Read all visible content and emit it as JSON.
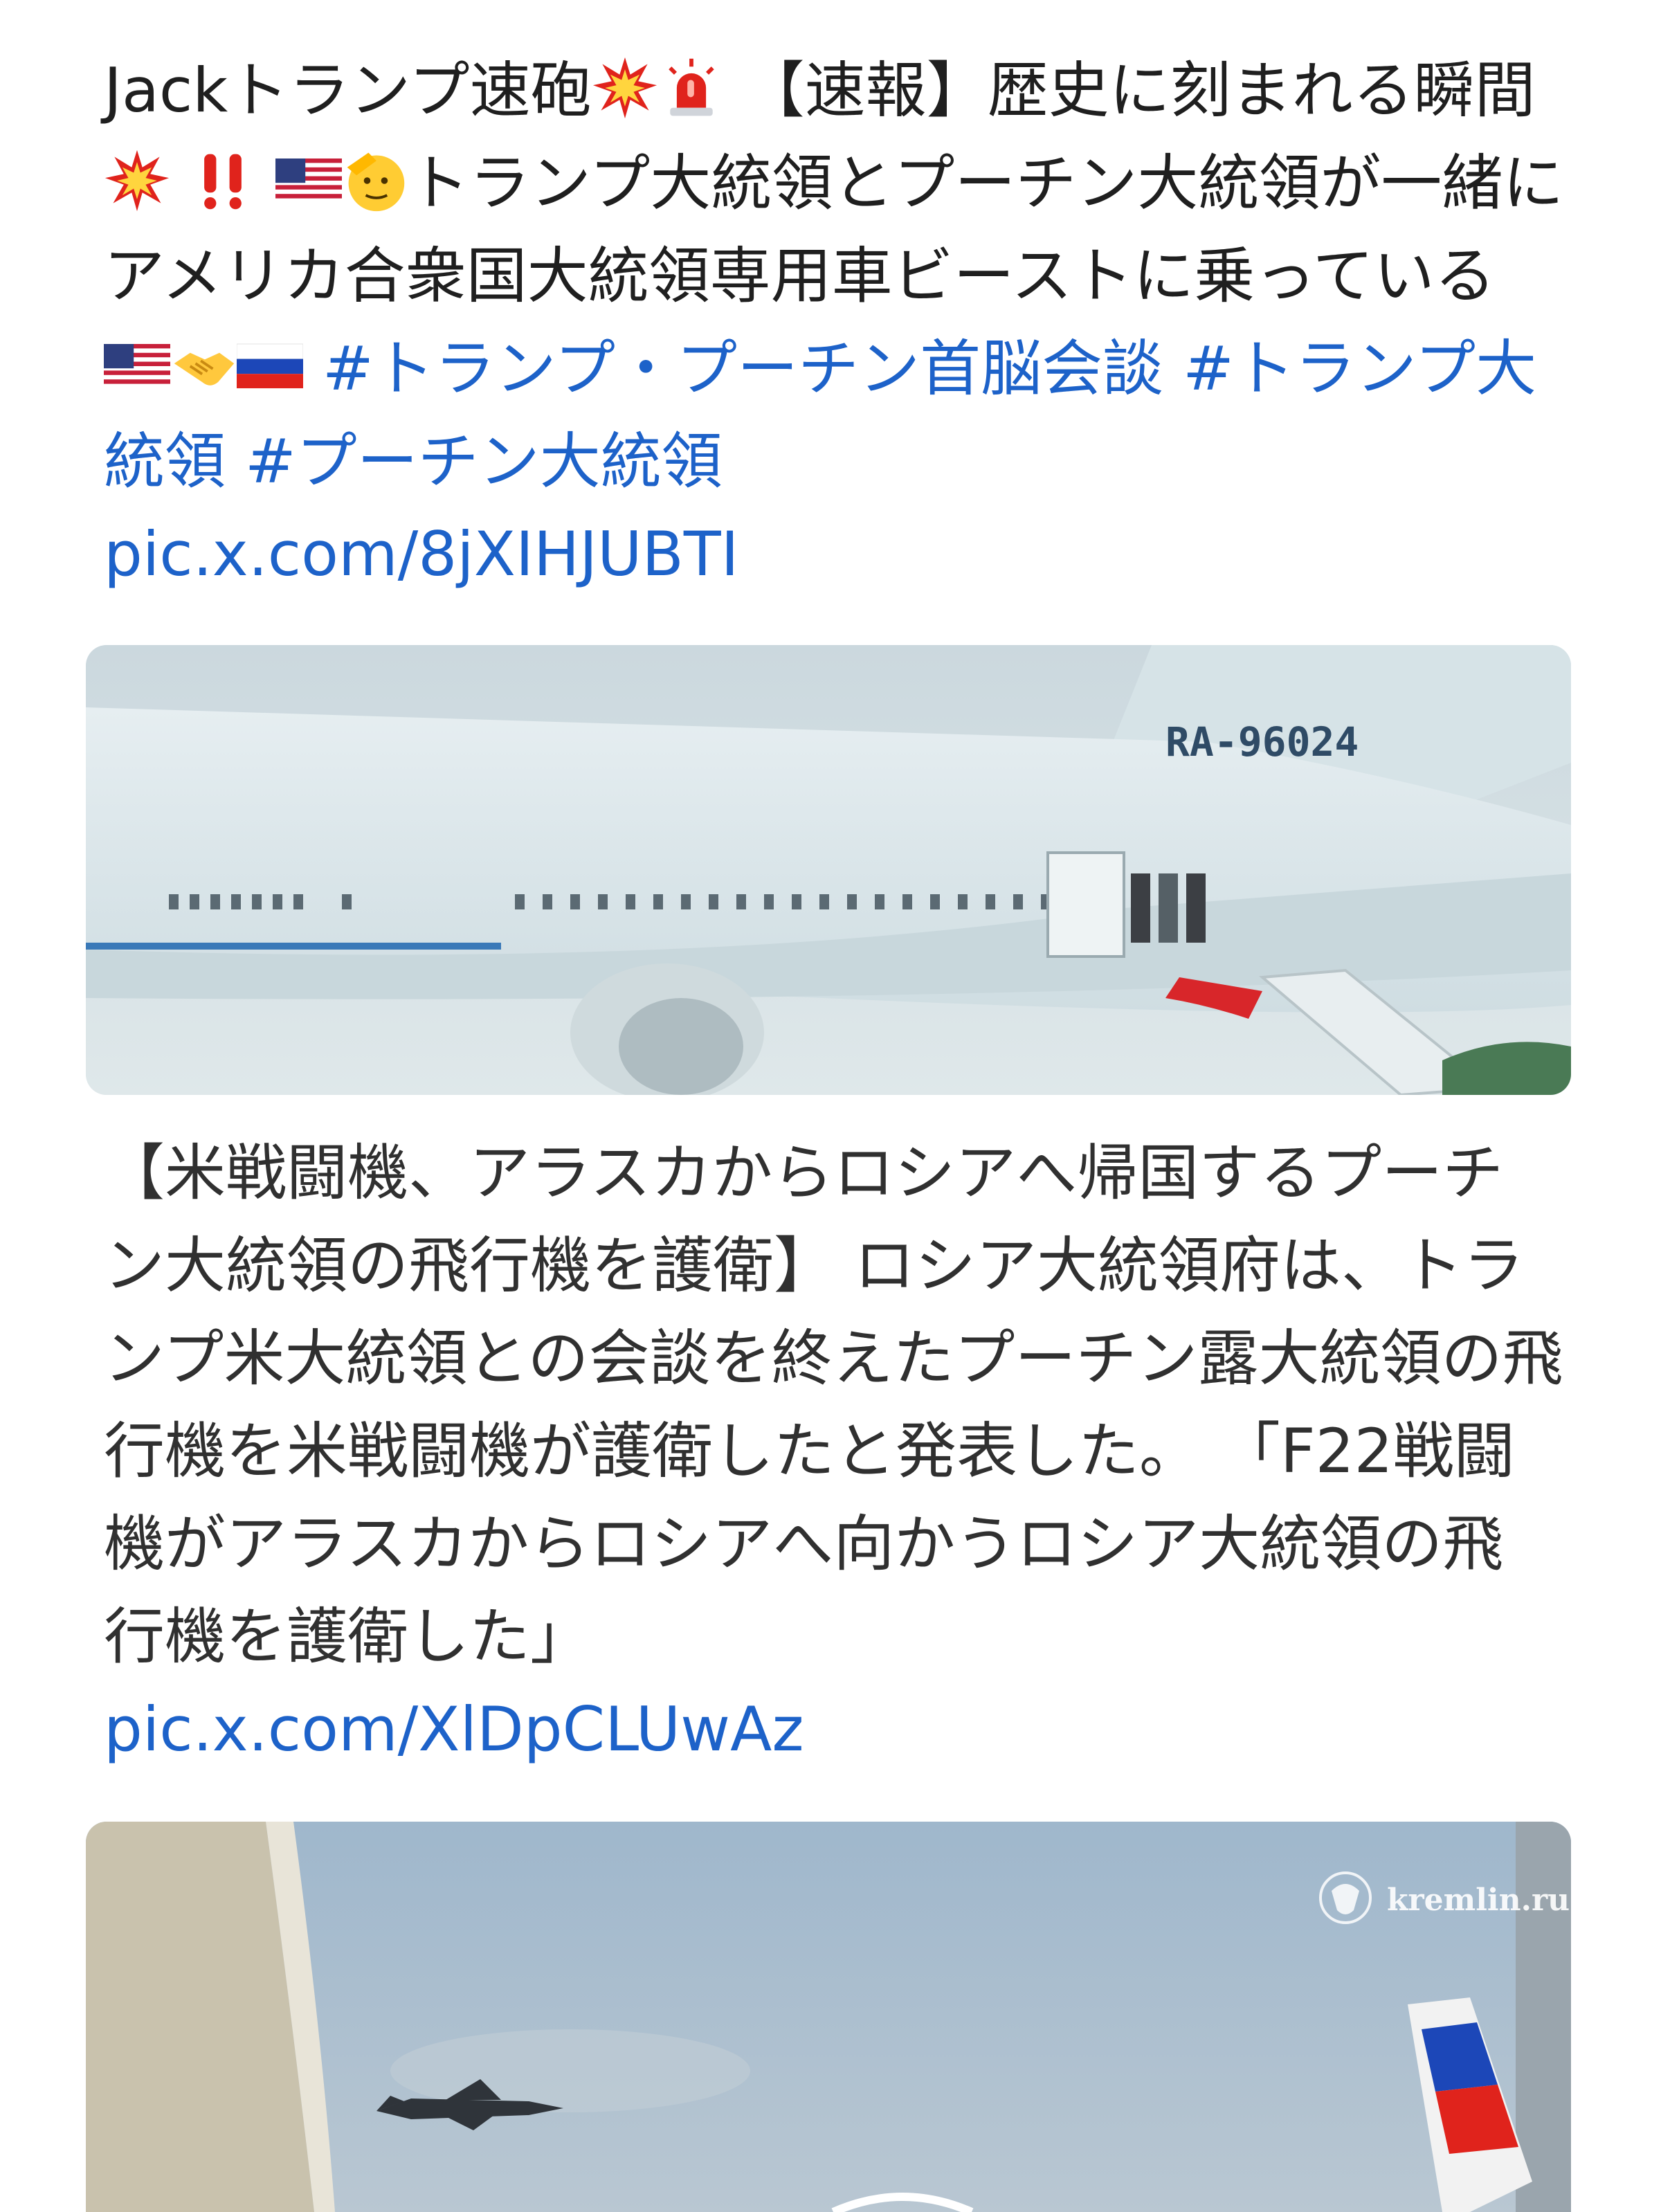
{
  "post1": {
    "text_intro": "Jackトランプ速砲",
    "text_headline": " 【速報】歴史に刻まれる瞬間",
    "text_body": "トランプ大統領とプーチン大統領が一緒にアメリカ合衆国大統領専用車ビーストに乗っている ",
    "hashtags": [
      "#トランプ・プーチン首脳会談",
      "#トランプ大統領",
      "#プーチン大統領"
    ],
    "link": "pic.x.com/8jXIHJUBTI",
    "emoji_icons": [
      "explosion-icon",
      "police-light-icon",
      "explosion-icon",
      "double-exclamation-icon",
      "us-flag-icon",
      "saluting-face-icon",
      "us-flag-icon",
      "handshake-icon",
      "russia-flag-icon"
    ],
    "media": {
      "registration": "RA-96024"
    }
  },
  "post2": {
    "text": "【米戦闘機、アラスカからロシアへ帰国するプーチン大統領の飛行機を護衛】 ロシア大統領府は、トランプ米大統領との会談を終えたプーチン露大統領の飛行機を米戦闘機が護衛したと発表した。 「F22戦闘機がアラスカからロシアへ向かうロシア大統領の飛行機を護衛した」",
    "link": "pic.x.com/XlDpCLUwAz",
    "media": {
      "watermark": "kremlin.ru"
    }
  },
  "colors": {
    "link": "#1d62c9",
    "text": "#1f1f1f",
    "background": "#ffffff"
  }
}
